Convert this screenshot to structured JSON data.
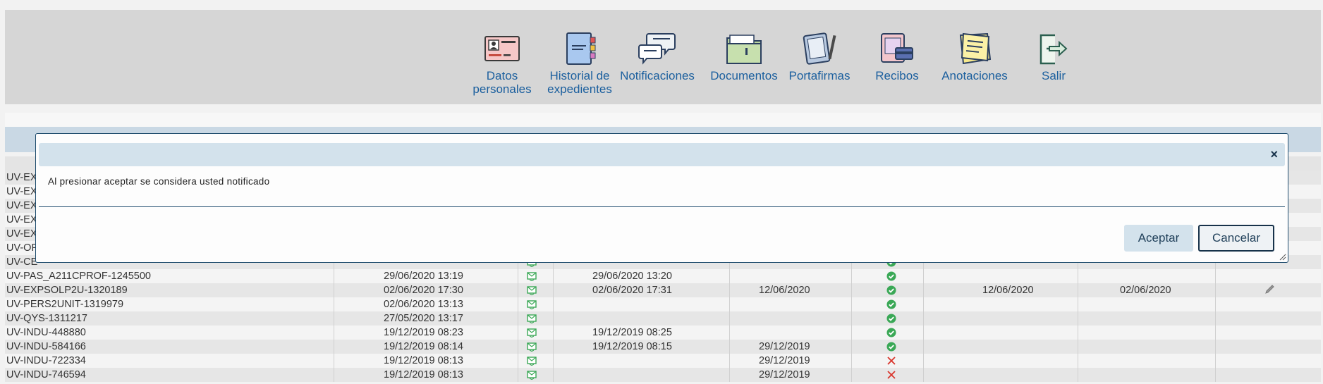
{
  "nav": {
    "items": [
      {
        "id": "datos",
        "label": "Datos personales"
      },
      {
        "id": "historial",
        "label": "Historial de expedientes"
      },
      {
        "id": "notificaciones",
        "label": "Notificaciones"
      },
      {
        "id": "documentos",
        "label": "Documentos"
      },
      {
        "id": "portafirmas",
        "label": "Portafirmas"
      },
      {
        "id": "recibos",
        "label": "Recibos"
      },
      {
        "id": "anotaciones",
        "label": "Anotaciones"
      },
      {
        "id": "salir",
        "label": "Salir"
      }
    ],
    "icons": [
      "id-card-icon",
      "notebook-icon",
      "chat-bubbles-icon",
      "folder-icon",
      "tablet-pen-icon",
      "receipt-card-icon",
      "sticky-note-icon",
      "logout-icon"
    ]
  },
  "table": {
    "rows": [
      {
        "exp": "UV-EX",
        "c1": "",
        "c3": "",
        "c4": "",
        "c6": "",
        "c7": ""
      },
      {
        "exp": "UV-EX",
        "c1": "",
        "c3": "",
        "c4": "",
        "c6": "",
        "c7": ""
      },
      {
        "exp": "UV-EX",
        "c1": "",
        "c3": "",
        "c4": "",
        "c6": "",
        "c7": ""
      },
      {
        "exp": "UV-EX",
        "c1": "",
        "c3": "",
        "c4": "",
        "c6": "",
        "c7": ""
      },
      {
        "exp": "UV-EX",
        "c1": "",
        "c3": "",
        "c4": "",
        "c6": "",
        "c7": ""
      },
      {
        "exp": "UV-OF",
        "c1": "",
        "c3": "",
        "c4": "",
        "c6": "",
        "c7": ""
      },
      {
        "exp": "UV-CE",
        "c1": "",
        "c3": "",
        "c4": "",
        "c6": "",
        "c7": ""
      },
      {
        "exp": "UV-PAS_A211CPROF-1245500",
        "c1": "29/06/2020 13:19",
        "c3": "29/06/2020 13:20",
        "c4": "",
        "c6": "",
        "c7": ""
      },
      {
        "exp": "UV-EXPSOLP2U-1320189",
        "c1": "02/06/2020 17:30",
        "c3": "02/06/2020 17:31",
        "c4": "12/06/2020",
        "c6": "12/06/2020",
        "c7": "02/06/2020"
      },
      {
        "exp": "UV-PERS2UNIT-1319979",
        "c1": "02/06/2020 13:13",
        "c3": "",
        "c4": "",
        "c6": "",
        "c7": ""
      },
      {
        "exp": "UV-QYS-1311217",
        "c1": "27/05/2020 13:17",
        "c3": "",
        "c4": "",
        "c6": "",
        "c7": ""
      },
      {
        "exp": "UV-INDU-448880",
        "c1": "19/12/2019 08:23",
        "c3": "19/12/2019 08:25",
        "c4": "",
        "c6": "",
        "c7": ""
      },
      {
        "exp": "UV-INDU-584166",
        "c1": "19/12/2019 08:14",
        "c3": "19/12/2019 08:15",
        "c4": "29/12/2019",
        "c6": "",
        "c7": ""
      },
      {
        "exp": "UV-INDU-722334",
        "c1": "19/12/2019 08:13",
        "c3": "",
        "c4": "29/12/2019",
        "c6": "",
        "c7": ""
      },
      {
        "exp": "UV-INDU-746594",
        "c1": "19/12/2019 08:13",
        "c3": "",
        "c4": "29/12/2019",
        "c6": "",
        "c7": ""
      }
    ],
    "status": [
      "none",
      "none",
      "none",
      "none",
      "none",
      "none",
      "check",
      "check",
      "check",
      "check",
      "check",
      "check",
      "check",
      "cross",
      "cross"
    ],
    "edit_row": 8
  },
  "modal": {
    "message": "Al presionar aceptar se considera usted notificado",
    "close_glyph": "×",
    "accept_label": "Aceptar",
    "cancel_label": "Cancelar"
  },
  "colors": {
    "nav_text": "#1b5f9e",
    "modal_border": "#1e4c6d",
    "modal_titlebar": "#d3e2ec",
    "check": "#3aa856",
    "cross": "#d9352c"
  }
}
